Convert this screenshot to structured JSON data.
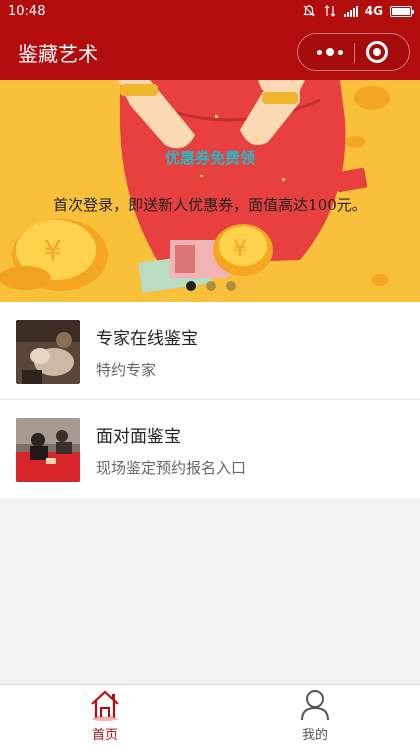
{
  "status_bar": {
    "time": "10:48",
    "network": "4G",
    "icons": [
      "mute-icon",
      "signal-icon",
      "battery-icon"
    ]
  },
  "nav": {
    "title": "鉴藏艺术",
    "brand_color": "#b30c0c"
  },
  "banner": {
    "headline": "优惠券免费领",
    "description": "首次登录，即送新人优惠券，面值高达100元。",
    "dot_count": 3,
    "active_dot": 0,
    "background": "#f9c13b"
  },
  "services": [
    {
      "title": "专家在线鉴宝",
      "subtitle": "特约专家"
    },
    {
      "title": "面对面鉴宝",
      "subtitle": "现场鉴定预约报名入口"
    }
  ],
  "tabbar": {
    "items": [
      {
        "label": "首页",
        "icon": "home-icon",
        "active": true
      },
      {
        "label": "我的",
        "icon": "user-icon",
        "active": false
      }
    ],
    "active_color": "#b30c0c"
  }
}
